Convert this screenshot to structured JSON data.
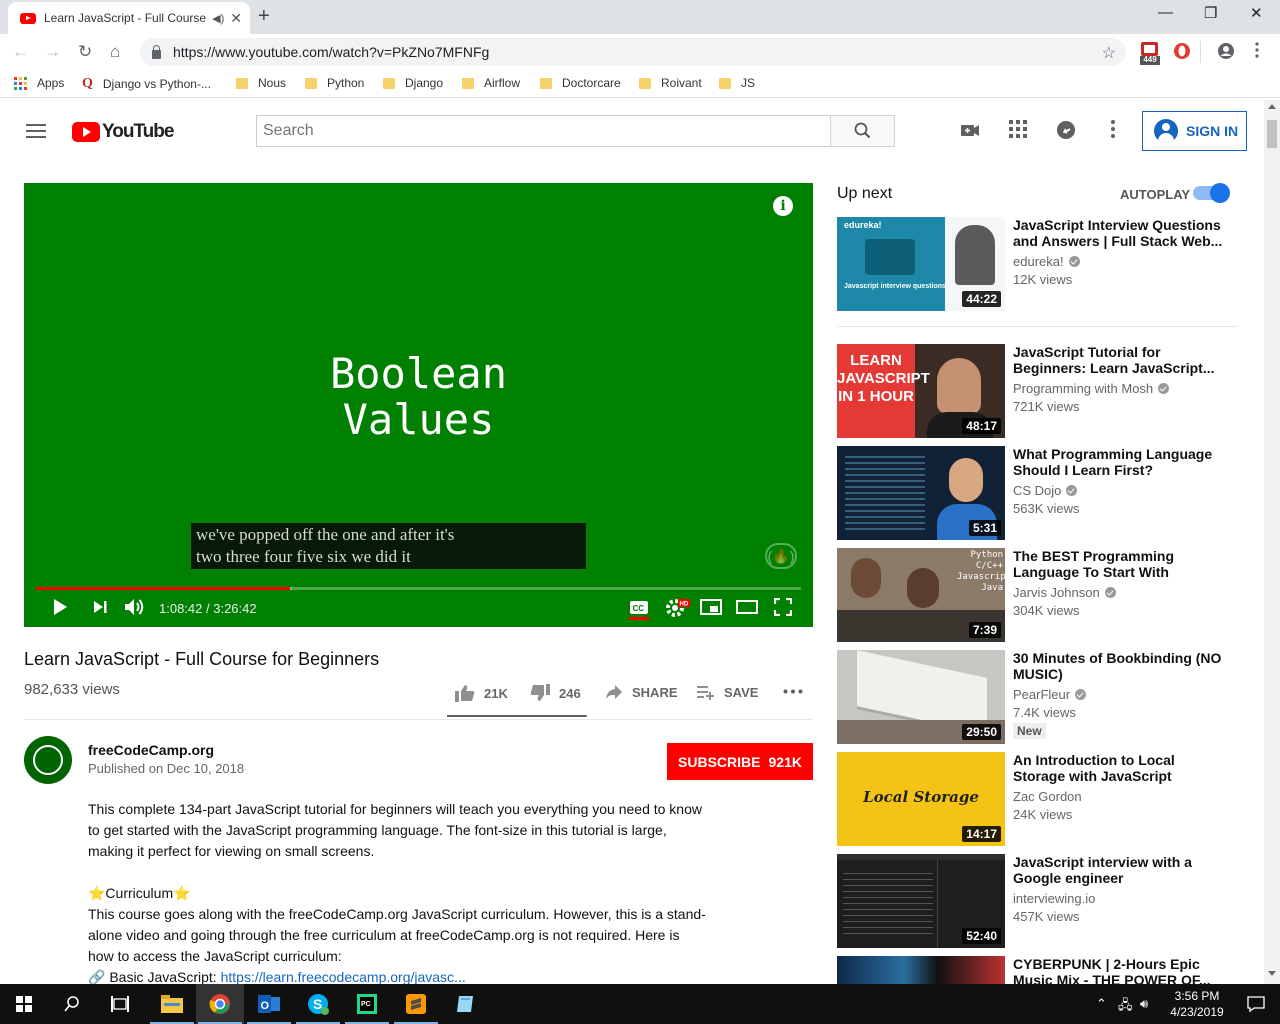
{
  "browser": {
    "tab_title": "Learn JavaScript - Full Course",
    "url": "https://www.youtube.com/watch?v=PkZNo7MFNFg",
    "extension_badge": "449",
    "bookmarks": [
      "Apps",
      "Django vs Python-...",
      "Nous",
      "Python",
      "Django",
      "Airflow",
      "Doctorcare",
      "Roivant",
      "JS"
    ]
  },
  "youtube": {
    "logo_text": "YouTube",
    "search_placeholder": "Search",
    "sign_in": "SIGN IN"
  },
  "player": {
    "slide_title_line1": "Boolean",
    "slide_title_line2": "Values",
    "caption_line1": "we've popped off the one and after it's",
    "caption_line2": "two three four five six we did it",
    "current_time": "1:08:42",
    "duration": "3:26:42",
    "progress_fraction": 0.3325,
    "buffered_fraction": 0.335,
    "bg_color": "#008000",
    "progress_color": "#ff0000"
  },
  "video": {
    "title": "Learn JavaScript - Full Course for Beginners",
    "views": "982,633 views",
    "likes": "21K",
    "dislikes": "246",
    "share": "SHARE",
    "save": "SAVE",
    "like_ratio": 0.99
  },
  "channel": {
    "name": "freeCodeCamp.org",
    "published": "Published on Dec 10, 2018",
    "subscribe_label": "SUBSCRIBE",
    "subscriber_count": "921K"
  },
  "description": {
    "para1": "This complete 134-part JavaScript tutorial for beginners will teach you everything you need to know to get started with the JavaScript programming language. The font-size in this tutorial is large, making it perfect for viewing on small screens.",
    "curriculum_heading": "⭐Curriculum⭐",
    "para2": "This course goes along with the freeCodeCamp.org JavaScript curriculum. However, this is a stand-alone video and going through the free curriculum at freeCodeCamp.org is not required. Here is how to access the JavaScript curriculum:",
    "link_label": "🔗 Basic JavaScript: ",
    "link_url": "https://learn.freecodecamp.org/javasc..."
  },
  "upnext": {
    "label": "Up next",
    "autoplay_label": "AUTOPLAY",
    "autoplay_on": true,
    "items": [
      {
        "title": "JavaScript Interview Questions and Answers | Full Stack Web...",
        "channel": "edureka!",
        "views": "12K views",
        "duration": "44:22",
        "verified": true,
        "thumb_text": "edureka!",
        "thumb_caption": "Javascript interview questions"
      },
      {
        "title": "JavaScript Tutorial for Beginners: Learn JavaScript...",
        "channel": "Programming with Mosh",
        "views": "721K views",
        "duration": "48:17",
        "verified": true,
        "thumb_text": "LEARN JAVASCRIPT IN 1 HOUR"
      },
      {
        "title": "What Programming Language Should I Learn First?",
        "channel": "CS Dojo",
        "views": "563K views",
        "duration": "5:31",
        "verified": true
      },
      {
        "title": "The BEST Programming Language To Start With",
        "channel": "Jarvis Johnson",
        "views": "304K views",
        "duration": "7:39",
        "verified": true,
        "thumb_text": "Python C/C++ Javascript Java"
      },
      {
        "title": "30 Minutes of Bookbinding (NO MUSIC)",
        "channel": "PearFleur",
        "views": "7.4K views",
        "duration": "29:50",
        "verified": true,
        "badge": "New"
      },
      {
        "title": "An Introduction to Local Storage with JavaScript",
        "channel": "Zac Gordon",
        "views": "24K views",
        "duration": "14:17",
        "verified": false,
        "thumb_text": "Local Storage"
      },
      {
        "title": "JavaScript interview with a Google engineer",
        "channel": "interviewing.io",
        "views": "457K views",
        "duration": "52:40",
        "verified": false
      },
      {
        "title": "CYBERPUNK | 2-Hours Epic Music Mix - THE POWER OF...",
        "channel": "",
        "views": "",
        "duration": "",
        "verified": false
      }
    ]
  },
  "taskbar": {
    "time": "3:56 PM",
    "date": "4/23/2019"
  }
}
